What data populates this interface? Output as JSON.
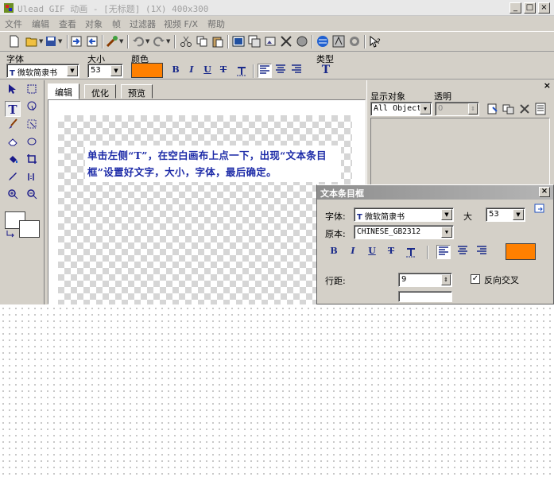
{
  "window": {
    "title": "Ulead GIF 动画 - [无标题] (1X) 400x300",
    "min": "_",
    "max": "□",
    "close": "×"
  },
  "menu": [
    "文件",
    "编辑",
    "查看",
    "对象",
    "帧",
    "过滤器",
    "视频 F/X",
    "帮助"
  ],
  "props": {
    "font_label": "字体",
    "font_value": "微软简隶书",
    "size_label": "大小",
    "size_value": "53",
    "color_label": "颜色",
    "type_label": "类型",
    "bold": "B",
    "italic": "I",
    "underline": "U",
    "strike": "T"
  },
  "tabs": [
    "编辑",
    "优化",
    "预览"
  ],
  "canvas_text": "单击左侧“T”，在空白画布上点一下，出现“文本条目框”设置好文字，大小，字体，最后确定。",
  "object_panel": {
    "show_label": "显示对象",
    "transparency_label": "透明",
    "objects_value": "All Objects",
    "transparency_value": "0",
    "close": "×"
  },
  "text_dialog": {
    "title": "文本条目框",
    "font_label": "字体:",
    "font_value": "微软简隶书",
    "size_label": "大",
    "size_value": "53",
    "script_label": "原本:",
    "script_value": "CHINESE_GB2312",
    "line_spacing_label": "行距:",
    "line_spacing_value": "9",
    "antialias_label": "反向交叉",
    "close": "×"
  },
  "colors": {
    "text_color": "#ff8000",
    "canvas_text": "#1e2ca8"
  }
}
